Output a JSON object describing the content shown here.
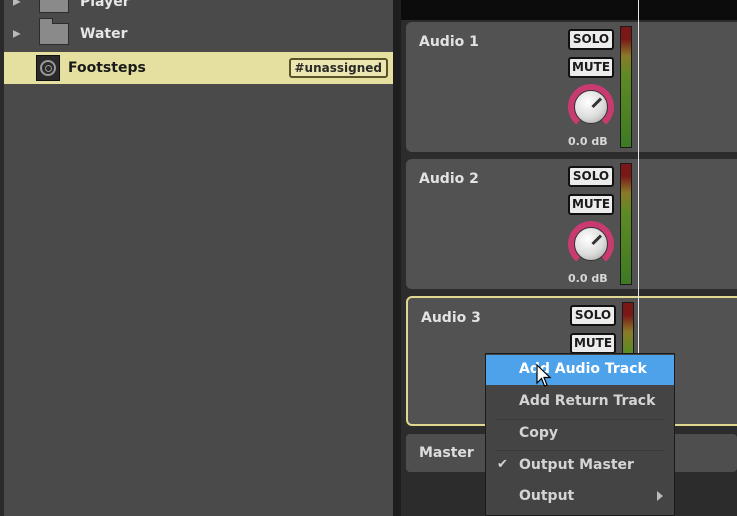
{
  "browser": {
    "items": [
      {
        "label": "Player",
        "type": "folder"
      },
      {
        "label": "Water",
        "type": "folder"
      },
      {
        "label": "Footsteps",
        "type": "event",
        "tag": "#unassigned",
        "selected": true
      }
    ]
  },
  "mixer": {
    "tracks": [
      {
        "name": "Audio 1",
        "solo": "SOLO",
        "mute": "MUTE",
        "volume": "0.0 dB"
      },
      {
        "name": "Audio 2",
        "solo": "SOLO",
        "mute": "MUTE",
        "volume": "0.0 dB"
      },
      {
        "name": "Audio 3",
        "solo": "SOLO",
        "mute": "MUTE",
        "selected": true
      }
    ],
    "master": "Master"
  },
  "context_menu": {
    "items": [
      {
        "label": "Add Audio Track",
        "highlighted": true
      },
      {
        "label": "Add Return Track"
      },
      {
        "label": "Copy"
      },
      {
        "label": "Output Master",
        "checked": true,
        "icon": "check-icon"
      },
      {
        "label": "Output",
        "icon": "submenu-arrow-icon"
      }
    ]
  },
  "colors": {
    "selection": "#e6e0a0",
    "menu_highlight": "#4ea2ea",
    "knob_ring": "#c83a70"
  }
}
